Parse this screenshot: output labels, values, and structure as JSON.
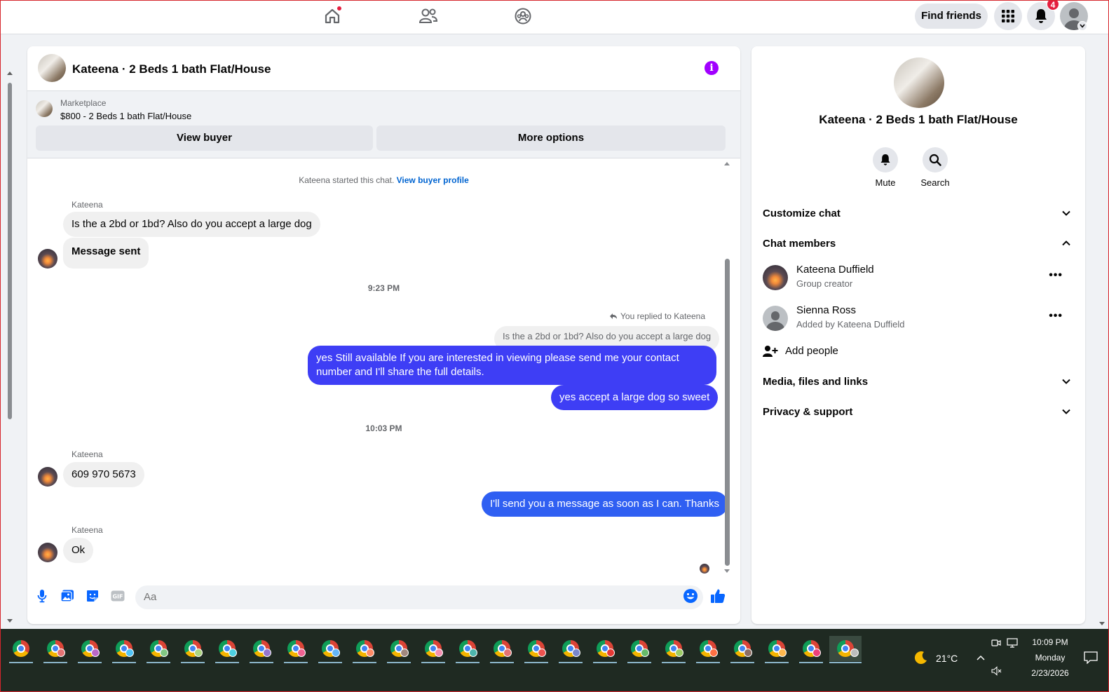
{
  "topbar": {
    "find_friends": "Find friends",
    "notification_count": "4"
  },
  "chat": {
    "title": "Kateena · 2 Beds 1 bath Flat/House",
    "marketplace_label": "Marketplace",
    "listing": "$800 - 2 Beds 1 bath Flat/House",
    "view_buyer": "View buyer",
    "more_options": "More options",
    "started_text": "Kateena started this chat.",
    "view_buyer_profile": "View buyer profile",
    "sender1": "Kateena",
    "msg1": "Is the a 2bd or 1bd? Also do you accept a large dog",
    "msg2": "Message sent",
    "time1": "9:23 PM",
    "replied_label": "You replied to Kateena",
    "quoted": "Is the a 2bd or 1bd? Also do you accept a large dog",
    "out1": "yes Still available If you are interested in viewing please send me your contact number and I'll share the full details.",
    "out2": "yes  accept a large dog so sweet",
    "time2": "10:03 PM",
    "sender2": "Kateena",
    "msg3": "609 970 5673",
    "out3": "I'll send you a message as soon as I can. Thanks",
    "sender3": "Kateena",
    "msg4": "Ok",
    "input_placeholder": "Aa",
    "gif_label": "GIF"
  },
  "side": {
    "title": "Kateena · 2 Beds 1 bath Flat/House",
    "mute": "Mute",
    "search": "Search",
    "customize": "Customize chat",
    "members": "Chat members",
    "member1_name": "Kateena Duffield",
    "member1_sub": "Group creator",
    "member2_name": "Sienna Ross",
    "member2_sub": "Added by Kateena Duffield",
    "add_people": "Add people",
    "media": "Media, files and links",
    "privacy": "Privacy & support"
  },
  "taskbar": {
    "temperature": "21°C",
    "time": "10:09 PM",
    "day": "Monday",
    "date": "2/23/2026"
  },
  "colors": {
    "accent": "#0866ff",
    "outgoing_bubble": "#3e3ef5",
    "info_icon": "#a100ff",
    "badge": "#e41e3f"
  }
}
